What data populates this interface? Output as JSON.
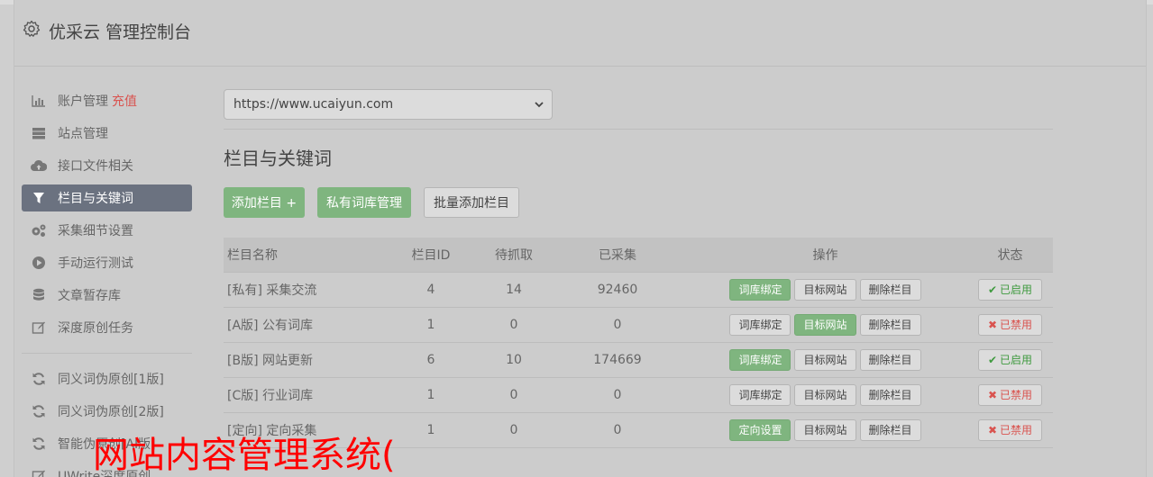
{
  "app": {
    "title": "优采云 管理控制台",
    "icon": "gear-icon"
  },
  "sidebar": {
    "items": [
      {
        "label": "账户管理",
        "badge": "充值",
        "icon": "bar-chart-icon"
      },
      {
        "label": "站点管理",
        "icon": "server-icon"
      },
      {
        "label": "接口文件相关",
        "icon": "cloud-upload-icon"
      },
      {
        "label": "栏目与关键词",
        "icon": "filter-icon",
        "active": true
      },
      {
        "label": "采集细节设置",
        "icon": "cogs-icon"
      },
      {
        "label": "手动运行测试",
        "icon": "play-circle-icon"
      },
      {
        "label": "文章暂存库",
        "icon": "database-icon"
      },
      {
        "label": "深度原创任务",
        "icon": "edit-icon"
      },
      {
        "label": "同义词伪原创[1版]",
        "icon": "refresh-icon"
      },
      {
        "label": "同义词伪原创[2版]",
        "icon": "refresh-icon"
      },
      {
        "label": "智能伪原创[AI版]",
        "icon": "refresh-icon"
      },
      {
        "label": "UWrite深度原创",
        "icon": "edit-icon"
      }
    ]
  },
  "main": {
    "site_select": {
      "value": "https://www.ucaiyun.com"
    },
    "section_title": "栏目与关键词",
    "buttons": {
      "add": "添加栏目 +",
      "private_lib": "私有词库管理",
      "batch_add": "批量添加栏目"
    }
  },
  "table": {
    "headers": [
      "栏目名称",
      "栏目ID",
      "待抓取",
      "已采集",
      "操作",
      "状态"
    ],
    "rows": [
      {
        "name": "[私有] 采集交流",
        "id": "4",
        "pending": "14",
        "collected": "92460",
        "op1": "词库绑定",
        "op2": "目标网站",
        "op3": "删除栏目",
        "status": "已启用",
        "status_mark": "✔"
      },
      {
        "name": "[A版] 公有词库",
        "id": "1",
        "pending": "0",
        "collected": "0",
        "op1": "词库绑定",
        "op2": "目标网站",
        "op3": "删除栏目",
        "status": "已禁用",
        "status_mark": "✖"
      },
      {
        "name": "[B版] 网站更新",
        "id": "6",
        "pending": "10",
        "collected": "174669",
        "op1": "词库绑定",
        "op2": "目标网站",
        "op3": "删除栏目",
        "status": "已启用",
        "status_mark": "✔"
      },
      {
        "name": "[C版] 行业词库",
        "id": "1",
        "pending": "0",
        "collected": "0",
        "op1": "词库绑定",
        "op2": "目标网站",
        "op3": "删除栏目",
        "status": "已禁用",
        "status_mark": "✖"
      },
      {
        "name": "[定向] 定向采集",
        "id": "1",
        "pending": "0",
        "collected": "0",
        "op1": "定向设置",
        "op2": "目标网站",
        "op3": "删除栏目",
        "status": "已禁用",
        "status_mark": "✖"
      }
    ]
  },
  "overlay_text": "网站内容管理系统(",
  "colors": {
    "accent_green": "#7fb57f",
    "active_sidebar": "#6b7280",
    "danger": "#d9534f",
    "overlay": "#ff0000"
  }
}
